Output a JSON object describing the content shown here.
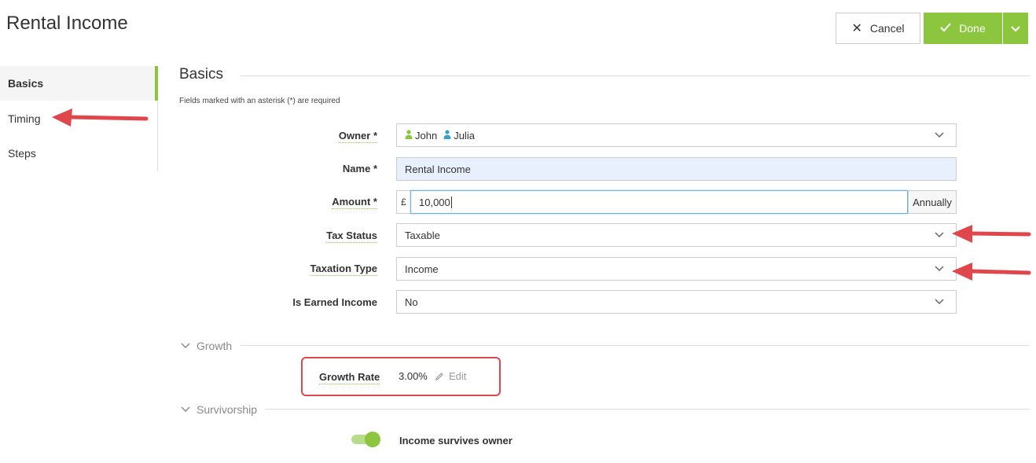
{
  "header": {
    "title": "Rental Income",
    "cancel_label": "Cancel",
    "done_label": "Done"
  },
  "sidebar": {
    "items": [
      {
        "label": "Basics",
        "active": true
      },
      {
        "label": "Timing",
        "active": false
      },
      {
        "label": "Steps",
        "active": false
      }
    ]
  },
  "section": {
    "title": "Basics",
    "required_note": "Fields marked with an asterisk (*) are required"
  },
  "form": {
    "owner": {
      "label": "Owner *",
      "values": [
        "John",
        "Julia"
      ]
    },
    "name": {
      "label": "Name *",
      "value": "Rental Income"
    },
    "amount": {
      "label": "Amount *",
      "prefix": "£",
      "value": "10,000",
      "suffix": "Annually"
    },
    "tax_status": {
      "label": "Tax Status",
      "value": "Taxable"
    },
    "taxation_type": {
      "label": "Taxation Type",
      "value": "Income"
    },
    "is_earned_income": {
      "label": "Is Earned Income",
      "value": "No"
    }
  },
  "growth": {
    "section_title": "Growth",
    "rate_label": "Growth Rate",
    "rate_value": "3.00%",
    "edit_label": "Edit"
  },
  "survivorship": {
    "section_title": "Survivorship",
    "toggle_label": "Income survives owner",
    "toggle_on": true
  },
  "colors": {
    "accent": "#8cc63f",
    "annotation": "#e0474c",
    "owner_john_icon": "#8cc63f",
    "owner_julia_icon": "#3aa0c8"
  }
}
